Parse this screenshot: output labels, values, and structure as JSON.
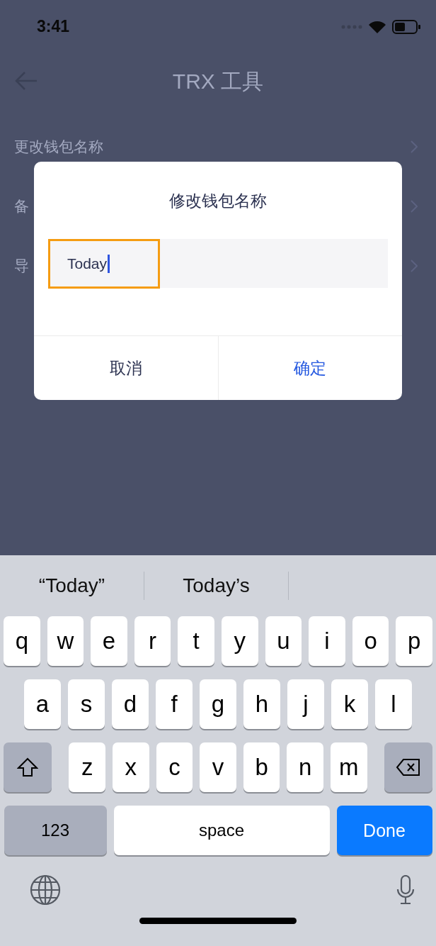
{
  "status_bar": {
    "time": "3:41"
  },
  "nav_bar": {
    "title": "TRX 工具"
  },
  "menu": [
    {
      "label": "更改钱包名称"
    },
    {
      "label": "备"
    },
    {
      "label": "导"
    }
  ],
  "dialog": {
    "title": "修改钱包名称",
    "name_field": {
      "value": "Today",
      "focused": true,
      "highlighted": true
    },
    "buttons": [
      {
        "label": "取消",
        "kind": "cancel"
      },
      {
        "label": "确定",
        "kind": "confirm"
      }
    ]
  },
  "keyboard": {
    "suggestions": [
      "“Today”",
      "Today’s"
    ],
    "top_letters": [
      {
        "kind": "letter",
        "label": "q"
      },
      {
        "kind": "letter",
        "label": "w"
      },
      {
        "kind": "letter",
        "label": "e"
      },
      {
        "kind": "letter",
        "label": "r"
      },
      {
        "kind": "letter",
        "label": "t"
      },
      {
        "kind": "letter",
        "label": "y"
      },
      {
        "kind": "letter",
        "label": "u"
      },
      {
        "kind": "letter",
        "label": "i"
      },
      {
        "kind": "letter",
        "label": "o"
      },
      {
        "kind": "letter",
        "label": "p"
      }
    ],
    "middle_letters": [
      {
        "kind": "letter",
        "label": "a"
      },
      {
        "kind": "letter",
        "label": "s"
      },
      {
        "kind": "letter",
        "label": "d"
      },
      {
        "kind": "letter",
        "label": "f"
      },
      {
        "kind": "letter",
        "label": "g"
      },
      {
        "kind": "letter",
        "label": "h"
      },
      {
        "kind": "letter",
        "label": "j"
      },
      {
        "kind": "letter",
        "label": "k"
      },
      {
        "kind": "letter",
        "label": "l"
      }
    ],
    "bottom_letters": [
      {
        "kind": "shift"
      },
      {
        "kind": "letter",
        "label": "z"
      },
      {
        "kind": "letter",
        "label": "x"
      },
      {
        "kind": "letter",
        "label": "c"
      },
      {
        "kind": "letter",
        "label": "v"
      },
      {
        "kind": "letter",
        "label": "b"
      },
      {
        "kind": "letter",
        "label": "n"
      },
      {
        "kind": "letter",
        "label": "m"
      },
      {
        "kind": "delete"
      }
    ],
    "action_keys": [
      {
        "kind": "numbers",
        "label": "123"
      },
      {
        "kind": "space",
        "label": "space"
      },
      {
        "kind": "done",
        "label": "Done"
      }
    ]
  }
}
